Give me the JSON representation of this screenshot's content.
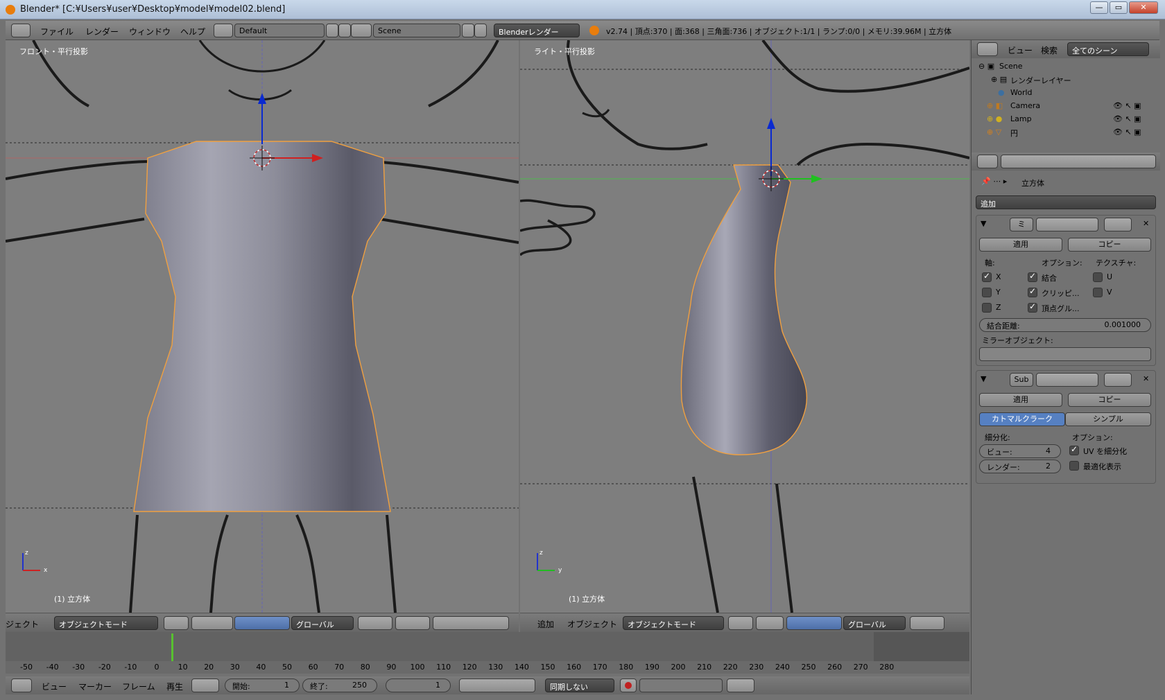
{
  "window": {
    "title": "Blender* [C:¥Users¥user¥Desktop¥model¥model02.blend]",
    "minimize": "—",
    "maximize": "▭",
    "close": "✕"
  },
  "topbar": {
    "menus": [
      "ファイル",
      "レンダー",
      "ウィンドウ",
      "ヘルプ"
    ],
    "layout": "Default",
    "scene": "Scene",
    "engine": "Blenderレンダー",
    "stats": "v2.74 | 頂点:370 | 面:368 | 三角面:736 | オブジェクト:1/1 | ランプ:0/0 | メモリ:39.96M | 立方体"
  },
  "left_view": {
    "label": "フロント・平行投影",
    "object": "(1) 立方体",
    "axis_z": "z",
    "axis_x": "x"
  },
  "right_view": {
    "label": "ライト・平行投影",
    "object": "(1) 立方体",
    "axis_z": "z",
    "axis_y": "y"
  },
  "left_header": {
    "menu_partial": "ジェクト",
    "mode": "オブジェクトモード",
    "orientation": "グローバル"
  },
  "right_header": {
    "menus": [
      "追加",
      "オブジェクト"
    ],
    "mode": "オブジェクトモード",
    "orientation": "グローバル"
  },
  "timeline": {
    "ticks": [
      "-50",
      "-40",
      "-30",
      "-20",
      "-10",
      "0",
      "10",
      "20",
      "30",
      "40",
      "50",
      "60",
      "70",
      "80",
      "90",
      "100",
      "110",
      "120",
      "130",
      "140",
      "150",
      "160",
      "170",
      "180",
      "190",
      "200",
      "210",
      "220",
      "230",
      "240",
      "250",
      "260",
      "270",
      "280"
    ]
  },
  "bottombar": {
    "menus": [
      "ビュー",
      "マーカー",
      "フレーム",
      "再生"
    ],
    "start_label": "開始:",
    "start": "1",
    "end_label": "終了:",
    "end": "250",
    "current": "1",
    "sync": "同期しない"
  },
  "outliner": {
    "header_menus": [
      "ビュー",
      "検索"
    ],
    "scene_filter": "全てのシーン",
    "rows": [
      "Scene",
      "レンダーレイヤー",
      "World",
      "Camera",
      "Lamp",
      "円"
    ]
  },
  "properties": {
    "breadcrumb": "立方体",
    "add_modifier": "追加",
    "mirror": {
      "name": "ミ",
      "apply": "適用",
      "copy": "コピー",
      "axis_label": "軸:",
      "options_label": "オプション:",
      "texture_label": "テクスチャ:",
      "x": "X",
      "y": "Y",
      "z": "Z",
      "merge": "結合",
      "clipping": "クリッピ...",
      "vgroups": "頂点グル...",
      "u": "U",
      "v": "V",
      "merge_limit_label": "結合距離:",
      "merge_limit": "0.001000",
      "mirror_object_label": "ミラーオブジェクト:"
    },
    "subsurf": {
      "name": "Sub",
      "apply": "適用",
      "copy": "コピー",
      "catmull": "カトマルクラーク",
      "simple": "シンプル",
      "subdiv_label": "細分化:",
      "options_label": "オプション:",
      "view_label": "ビュー:",
      "view": "4",
      "render_label": "レンダー:",
      "render": "2",
      "uv": "UV を細分化",
      "optimal": "最適化表示"
    }
  },
  "colors": {
    "accent": "#5680c2",
    "selection": "#f0a040",
    "frame_marker": "#58c030"
  }
}
